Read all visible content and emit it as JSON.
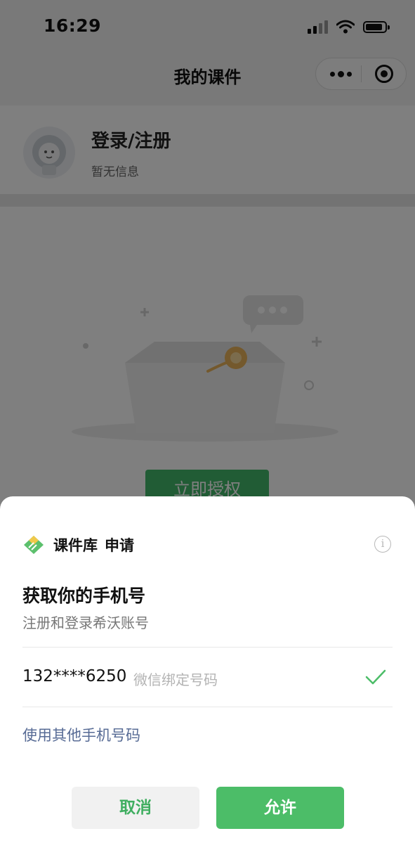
{
  "status_bar": {
    "time": "16:29"
  },
  "nav": {
    "title": "我的课件"
  },
  "profile": {
    "login_label": "登录/注册",
    "info_label": "暂无信息"
  },
  "content": {
    "authorize_button": "立即授权"
  },
  "sheet": {
    "app_name": "课件库",
    "action": "申请",
    "title": "获取你的手机号",
    "subtitle": "注册和登录希沃账号",
    "phone_number": "132****6250",
    "phone_tag": "微信绑定号码",
    "other_phone": "使用其他手机号码",
    "cancel_label": "取消",
    "allow_label": "允许",
    "info_glyph": "i"
  },
  "colors": {
    "accent_green": "#4cbd68",
    "link_blue": "#576b95",
    "mask": "rgba(0,0,0,0.5)"
  },
  "icons": [
    "signal-icon",
    "wifi-icon",
    "battery-icon",
    "more-icon",
    "close-target-icon",
    "info-icon",
    "check-icon",
    "app-logo-icon"
  ]
}
